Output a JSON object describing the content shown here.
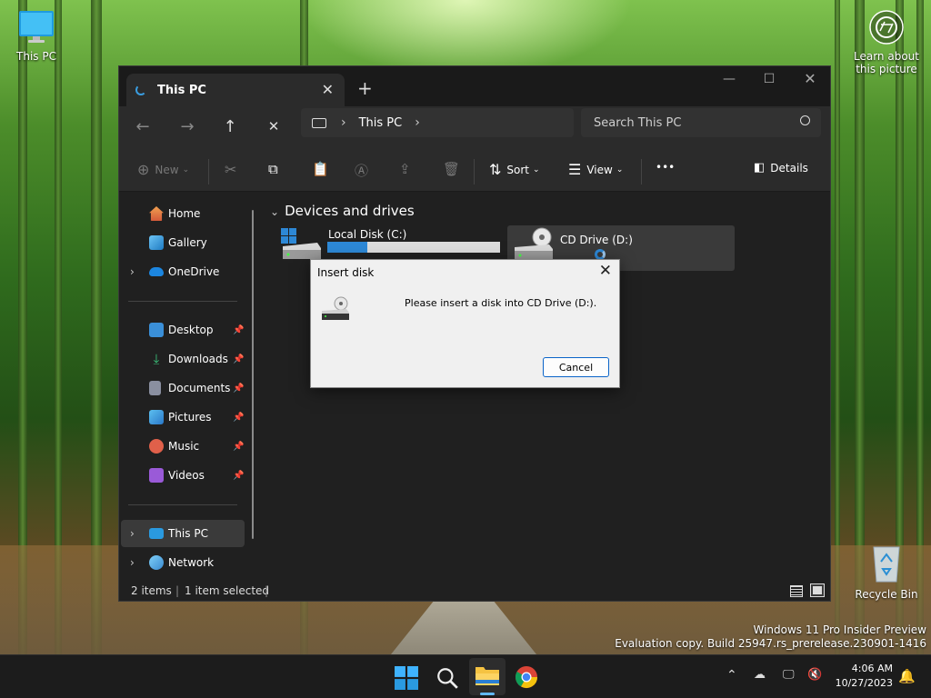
{
  "desktop": {
    "this_pc_label": "This PC",
    "learn_picture_label_line1": "Learn about",
    "learn_picture_label_line2": "this picture",
    "recycle_bin_label": "Recycle Bin",
    "watermark_line1": "Windows 11 Pro Insider Preview",
    "watermark_line2": "Evaluation copy. Build 25947.rs_prerelease.230901-1416"
  },
  "explorer": {
    "tab_title": "This PC",
    "address": {
      "location": "This PC"
    },
    "search": {
      "placeholder": "Search This PC"
    },
    "commands": {
      "new_label": "New",
      "sort_label": "Sort",
      "view_label": "View",
      "more_label": "•••",
      "details_label": "Details"
    },
    "sidebar": {
      "items": [
        {
          "label": "Home"
        },
        {
          "label": "Gallery"
        },
        {
          "label": "OneDrive"
        },
        {
          "label": "Desktop"
        },
        {
          "label": "Downloads"
        },
        {
          "label": "Documents"
        },
        {
          "label": "Pictures"
        },
        {
          "label": "Music"
        },
        {
          "label": "Videos"
        },
        {
          "label": "This PC"
        },
        {
          "label": "Network"
        }
      ]
    },
    "content": {
      "section_title": "Devices and drives",
      "drives": [
        {
          "name": "Local Disk (C:)",
          "used_fraction": 0.23
        },
        {
          "name": "CD Drive (D:)"
        }
      ]
    },
    "status": {
      "item_count": "2 items",
      "selection": "1 item selected"
    }
  },
  "dialog": {
    "title": "Insert disk",
    "message": "Please insert a disk into CD Drive (D:).",
    "cancel_label": "Cancel"
  },
  "taskbar": {
    "time": "4:06 AM",
    "date": "10/27/2023"
  },
  "colors": {
    "accent": "#2d88d6",
    "window_bg": "#202020",
    "dialog_bg": "#f0f0f0"
  }
}
